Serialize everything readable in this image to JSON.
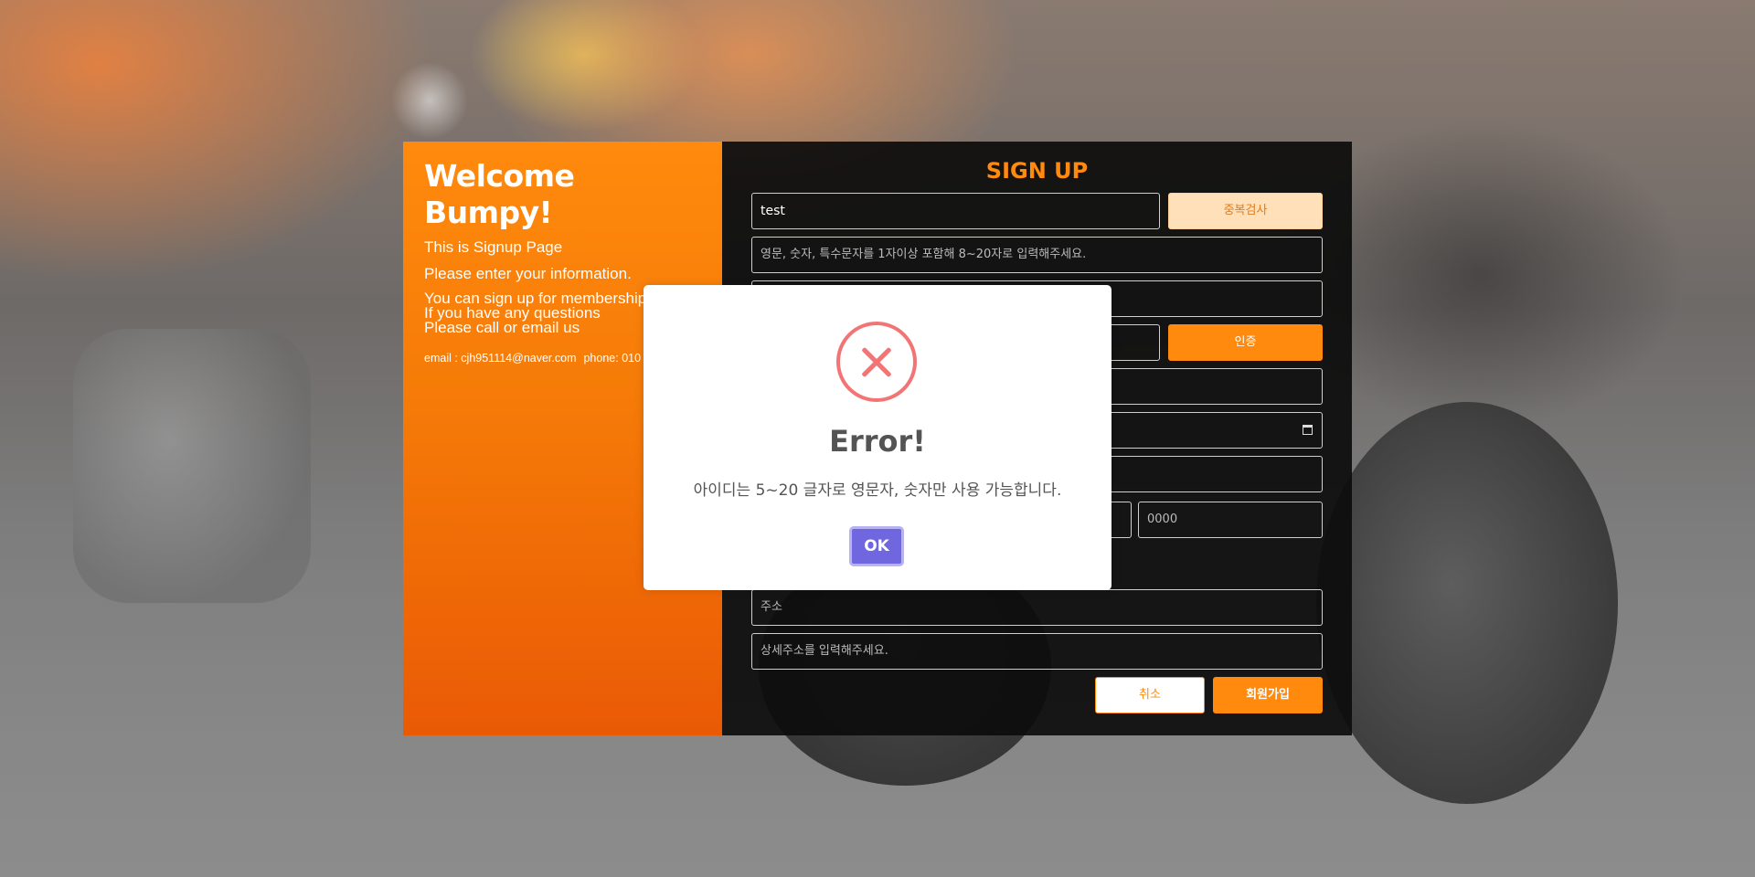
{
  "left": {
    "welcome": "Welcome Bumpy!",
    "line1": "This is Signup Page",
    "line2": "Please enter your information.",
    "line3a": "You can sign up for membership",
    "line3b": "If you have any questions",
    "line3c": "Please call or email us",
    "email": "email : cjh951114@naver.com",
    "phone": "phone: 010"
  },
  "form": {
    "title": "SIGN UP",
    "id_value": "test",
    "dup_check_label": "중복검사",
    "password_placeholder": "영문, 숫자, 특수문자를 1자이상 포함해 8~20자로 입력해주세요.",
    "auth_label": "인증",
    "phone_last_placeholder": "0000",
    "address_placeholder": "주소",
    "address_detail_placeholder": "상세주소를 입력해주세요.",
    "cancel_label": "취소",
    "submit_label": "회원가입"
  },
  "modal": {
    "title": "Error!",
    "message": "아이디는 5~20 글자로 영문자, 숫자만 사용 가능합니다.",
    "ok_label": "OK",
    "icon": "error-x-icon",
    "ok_color": "#7066e0",
    "icon_color": "#f27474"
  },
  "colors": {
    "accent": "#ff8a0d",
    "panel_dark": "#0c0c0c"
  }
}
